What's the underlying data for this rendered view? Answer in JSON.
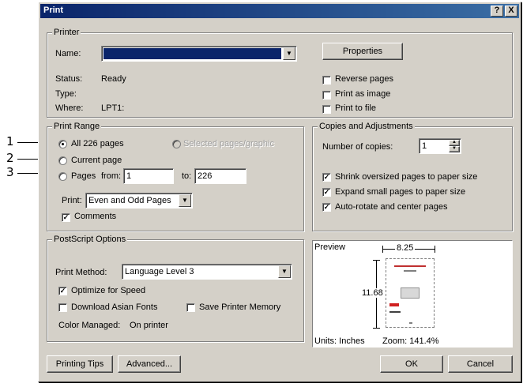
{
  "title": "Print",
  "title_buttons": {
    "help": "?",
    "close": "X"
  },
  "printer": {
    "legend": "Printer",
    "name_label": "Name:",
    "name_value": "",
    "properties_button": "Properties",
    "status_label": "Status:",
    "status_value": "Ready",
    "type_label": "Type:",
    "type_value": "",
    "where_label": "Where:",
    "where_value": "LPT1:",
    "reverse_pages": "Reverse pages",
    "print_as_image": "Print as image",
    "print_to_file": "Print to file"
  },
  "print_range": {
    "legend": "Print Range",
    "all_pages": "All 226 pages",
    "selected_pages": "Selected pages/graphic",
    "current_page": "Current page",
    "pages": "Pages",
    "from_label": "from:",
    "from_value": "1",
    "to_label": "to:",
    "to_value": "226",
    "print_label": "Print:",
    "print_value": "Even and Odd Pages",
    "comments": "Comments"
  },
  "copies": {
    "legend": "Copies and Adjustments",
    "number_label": "Number of copies:",
    "number_value": "1",
    "shrink": "Shrink oversized pages to paper size",
    "expand": "Expand small pages to paper size",
    "autorotate": "Auto-rotate and center pages"
  },
  "postscript": {
    "legend": "PostScript Options",
    "method_label": "Print Method:",
    "method_value": "Language Level 3",
    "optimize": "Optimize for Speed",
    "download_fonts": "Download Asian Fonts",
    "save_memory": "Save Printer Memory",
    "color_managed_label": "Color Managed:",
    "color_managed_value": "On printer"
  },
  "preview": {
    "label": "Preview",
    "width": "8.25",
    "height": "11.68",
    "units": "Units: Inches",
    "zoom": "Zoom: 141.4%"
  },
  "buttons": {
    "printing_tips": "Printing Tips",
    "advanced": "Advanced...",
    "ok": "OK",
    "cancel": "Cancel"
  },
  "callouts": [
    "1",
    "2",
    "3"
  ],
  "colors": {
    "dialog_bg": "#d4d0c8",
    "title_start": "#0a246a",
    "title_end": "#3a6ea5",
    "selection": "#0a246a"
  }
}
